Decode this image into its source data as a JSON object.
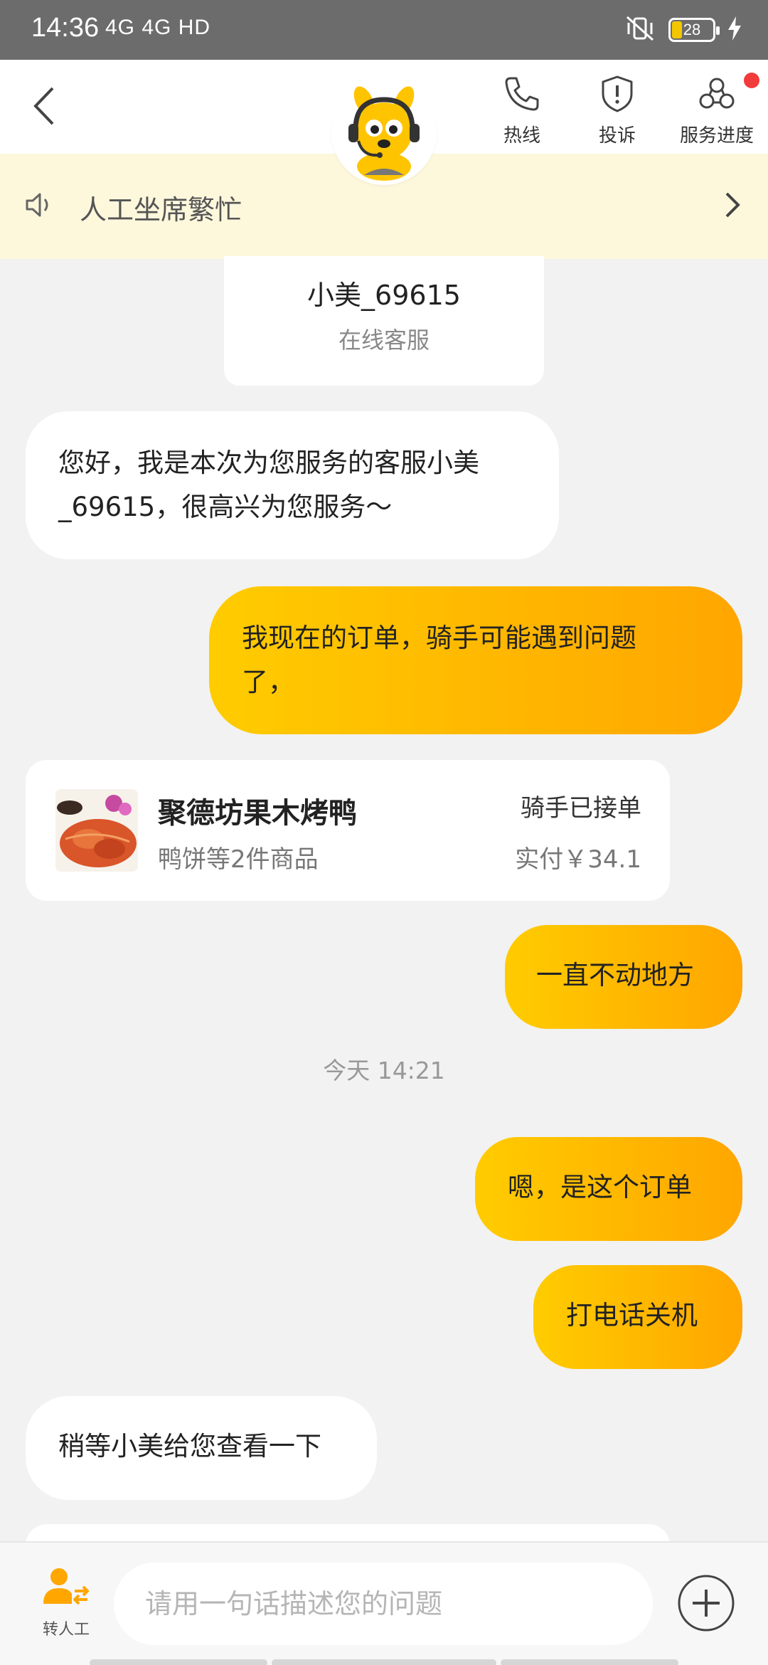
{
  "status_bar": {
    "time": "14:36",
    "network": "4G 4G HD",
    "battery": "28"
  },
  "header": {
    "actions": [
      {
        "label": "热线",
        "icon": "phone-icon"
      },
      {
        "label": "投诉",
        "icon": "shield-alert-icon"
      },
      {
        "label": "服务进度",
        "icon": "service-progress-icon"
      }
    ],
    "colors": {
      "accent": "#ffb800",
      "badge": "#f23b3b"
    }
  },
  "notice": {
    "text": "人工坐席繁忙"
  },
  "agent": {
    "name": "小美_69615",
    "role": "在线客服"
  },
  "messages": {
    "m1": {
      "line1": "您好，我是本次为您服务的客服小美",
      "line2": "_69615，很高兴为您服务～"
    },
    "m2": {
      "line1": "我现在的订单，骑手可能遇到问题",
      "line2": "了，"
    },
    "m3": "一直不动地方",
    "m4": "嗯，是这个订单",
    "m5": "打电话关机",
    "m6": "稍等小美给您查看一下"
  },
  "order": {
    "shop": "聚德坊果木烤鸭",
    "items": "鸭饼等2件商品",
    "status": "骑手已接单",
    "paid": "实付￥34.1"
  },
  "timestamp": "今天 14:21",
  "bottom": {
    "transfer_label": "转人工",
    "input_placeholder": "请用一句话描述您的问题"
  }
}
